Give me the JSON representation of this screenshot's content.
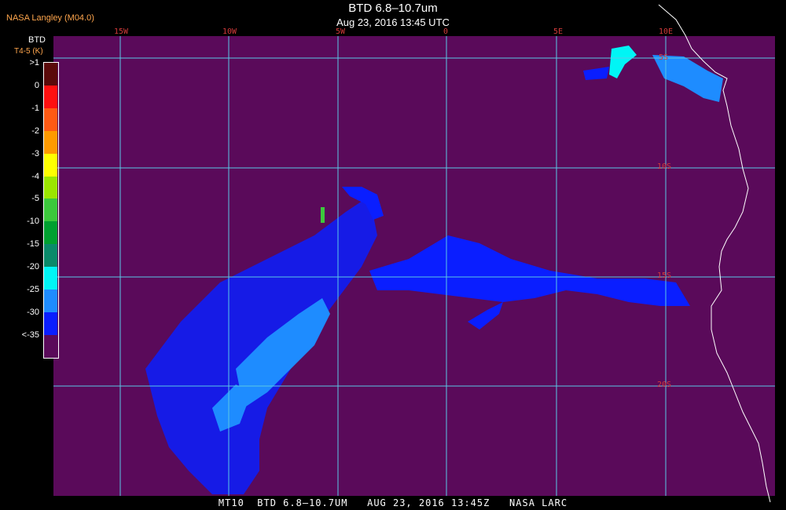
{
  "header": {
    "source": "NASA Langley (M04.0)",
    "title": "BTD 6.8–10.7um",
    "subtitle": "Aug 23, 2016 13:45 UTC"
  },
  "footer": {
    "text": "MT10  BTD 6.8–10.7UM   AUG 23, 2016 13:45Z   NASA LARC"
  },
  "legend": {
    "name": "BTD",
    "unit": "T4-5 (K)",
    "entries": [
      {
        "label": ">1",
        "color": "#5a0a0a"
      },
      {
        "label": "0",
        "color": "#ff1010"
      },
      {
        "label": "-1",
        "color": "#ff5a14"
      },
      {
        "label": "-2",
        "color": "#ff9a00"
      },
      {
        "label": "-3",
        "color": "#ffff00"
      },
      {
        "label": "-4",
        "color": "#9be600"
      },
      {
        "label": "-5",
        "color": "#3cc83c"
      },
      {
        "label": "-10",
        "color": "#00a030"
      },
      {
        "label": "-15",
        "color": "#0a8a6a"
      },
      {
        "label": "-20",
        "color": "#00f5f5"
      },
      {
        "label": "-25",
        "color": "#1e8cff"
      },
      {
        "label": "-30",
        "color": "#0a1eff"
      },
      {
        "label": "<-35",
        "color": "#5a0a5a"
      }
    ]
  },
  "map": {
    "background_color": "#5a0a5a",
    "grid_color": "#5ac8e6",
    "coast_color": "#ffffff",
    "lon_labels": [
      "15W",
      "10W",
      "5W",
      "0",
      "5E",
      "10E"
    ],
    "lat_labels": [
      "5S",
      "10S",
      "15S",
      "20S"
    ]
  }
}
